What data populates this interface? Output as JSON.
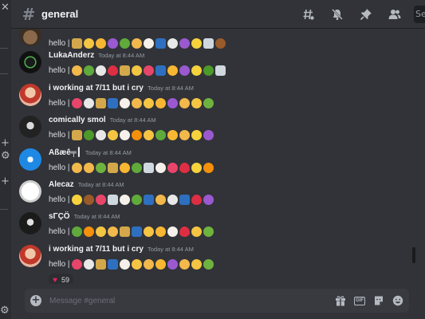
{
  "channel": {
    "name": "general",
    "hash": "#"
  },
  "sidebar_sliver": {
    "labels": [
      "+",
      "+",
      "+"
    ]
  },
  "header_icons": [
    "threads-icon",
    "mute-icon",
    "pin-icon",
    "members-icon"
  ],
  "search": {
    "placeholder": "Se"
  },
  "messages": [
    {
      "username": "",
      "timestamp": "",
      "text": "hello |",
      "emojis": [
        "money-bag",
        "cowboy",
        "heart-eyes",
        "devil",
        "snake",
        "scream-cry",
        "clown",
        "sponge",
        "skull",
        "devil",
        "lemon",
        "martini",
        "football"
      ]
    },
    {
      "username": "LukaAnderz",
      "timestamp": "Today at 8:44 AM",
      "text": "hello |",
      "emojis": [
        "scream-cry",
        "snake",
        "skull",
        "heart",
        "money-bag",
        "cowboy",
        "party",
        "sponge",
        "heart-eyes",
        "devil",
        "lemon",
        "palm",
        "martini"
      ]
    },
    {
      "username": "i working at 7/11 but i cry",
      "timestamp": "Today at 8:44 AM",
      "text": "hello |",
      "emojis": [
        "party",
        "skull",
        "money-bag",
        "sponge",
        "clown",
        "scream-cry",
        "scream",
        "heart-eyes",
        "devil",
        "scream-cry",
        "cowboy",
        "sick"
      ]
    },
    {
      "username": "comically smol",
      "timestamp": "Today at 8:44 AM",
      "text": "hello |",
      "emojis": [
        "money-bag",
        "palm",
        "skull",
        "cowboy",
        "clown",
        "fire",
        "scream",
        "snake",
        "heart-eyes",
        "scream-cry",
        "lemon",
        "devil"
      ]
    },
    {
      "username": "Aßæê╤┃",
      "timestamp": "Today at 8:44 AM",
      "text": "hello |",
      "emojis": [
        "scream-cry",
        "scream-cry",
        "sick",
        "money-bag",
        "heart-eyes",
        "snake",
        "martini",
        "clown",
        "party",
        "heart",
        "lemon",
        "fire"
      ]
    },
    {
      "username": "Alecaz",
      "timestamp": "Today at 8:44 AM",
      "text": "hello |",
      "emojis": [
        "lemon",
        "football",
        "party",
        "martini",
        "clown",
        "snake",
        "sponge",
        "scream-cry",
        "skull",
        "sponge",
        "heart",
        "devil"
      ]
    },
    {
      "username": "sΓÇÖ",
      "timestamp": "Today at 8:44 AM",
      "text": "hello |",
      "emojis": [
        "snake",
        "fire",
        "cowboy",
        "scream-cry",
        "money-bag",
        "sponge",
        "scream",
        "heart-eyes",
        "clown",
        "heart",
        "cowboy",
        "sick"
      ]
    },
    {
      "username": "i working at 7/11 but i cry",
      "timestamp": "Today at 8:44 AM",
      "text": "hello |",
      "emojis": [
        "party",
        "skull",
        "money-bag",
        "sponge",
        "clown",
        "scream",
        "scream-cry",
        "heart-eyes",
        "devil",
        "scream-cry",
        "cowboy",
        "sick"
      ],
      "reaction": {
        "emoji": "♥",
        "count": "59"
      }
    }
  ],
  "emoji_colors": {
    "money-bag": "#d4a84a",
    "cowboy": "#f4c542",
    "heart-eyes": "#f7b733",
    "devil": "#9b59d0",
    "snake": "#5faa3b",
    "scream-cry": "#f2b84b",
    "clown": "#f5f0ea",
    "sponge": "#2f6fbf",
    "skull": "#e8e8e8",
    "lemon": "#f6d23c",
    "martini": "#cfd8de",
    "football": "#9a5a2a",
    "heart": "#dd2e44",
    "party": "#e8456a",
    "palm": "#4c9a2a",
    "scream": "#f6c443",
    "sick": "#6fb33f",
    "fire": "#f4900c"
  },
  "composer": {
    "placeholder": "Message #general",
    "icons": [
      "gift-icon",
      "gif-icon",
      "sticker-icon",
      "emoji-icon"
    ],
    "gif_label": "GIF"
  }
}
